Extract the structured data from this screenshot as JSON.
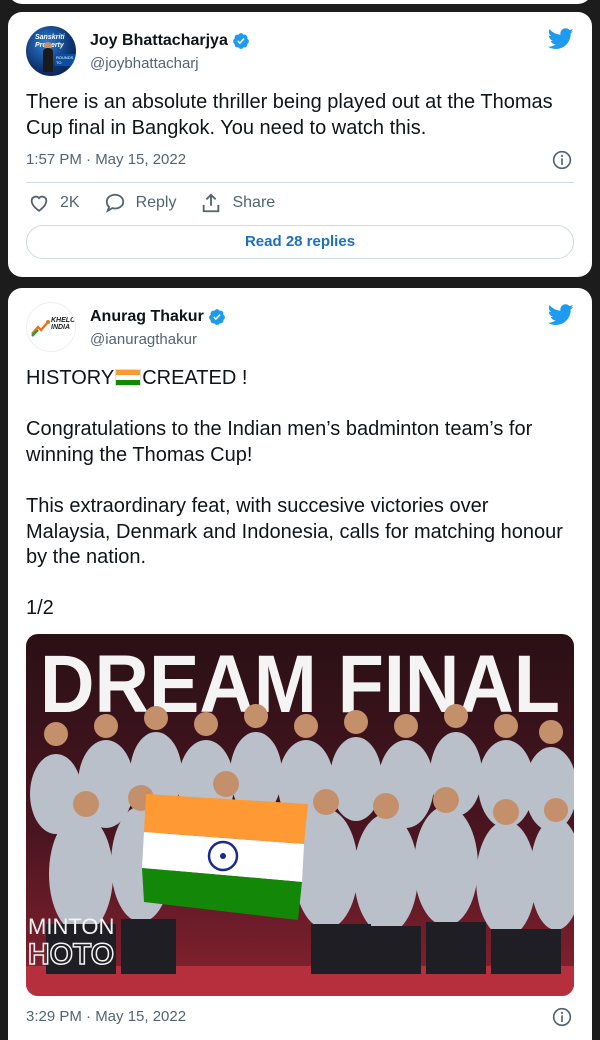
{
  "tweet1": {
    "author_name": "Joy Bhattacharjya",
    "handle": "@joybhattacharj",
    "avatar_text_line1": "Sanskriti",
    "avatar_text_line2": "Property",
    "avatar_tag": "ROUNDS TO",
    "text": "There is an absolute thriller being played out at the Thomas Cup final in Bangkok. You need to watch this.",
    "timestamp": "1:57 PM · May 15, 2022",
    "likes": "2K",
    "reply_label": "Reply",
    "share_label": "Share",
    "read_replies_label": "Read 28 replies"
  },
  "tweet2": {
    "author_name": "Anurag Thakur",
    "handle": "@ianuragthakur",
    "avatar_logo_line1": "KHELO",
    "avatar_logo_line2": "INDIA",
    "headline_before": "HISTORY",
    "headline_after": "CREATED !",
    "paragraph1": "Congratulations to the Indian men’s badminton team’s for winning the Thomas Cup!",
    "paragraph2": "This extraordinary feat, with succesive victories over Malaysia, Denmark and Indonesia, calls for matching honour by the nation.",
    "thread_count": "1/2",
    "image": {
      "headline": "DREAM FINAL",
      "watermark_line1": "MINTON",
      "watermark_line2": "HOTO"
    },
    "timestamp": "3:29 PM · May 15, 2022"
  },
  "colors": {
    "twitter_blue": "#1d9bf0",
    "link_blue": "#1d6fc2",
    "muted": "#536471",
    "text": "#0f1419",
    "background": "#1c1c1c"
  },
  "icons": [
    "twitter-bird-icon",
    "verified-badge-icon",
    "heart-icon",
    "reply-bubble-icon",
    "share-icon",
    "info-icon",
    "india-flag-icon"
  ]
}
